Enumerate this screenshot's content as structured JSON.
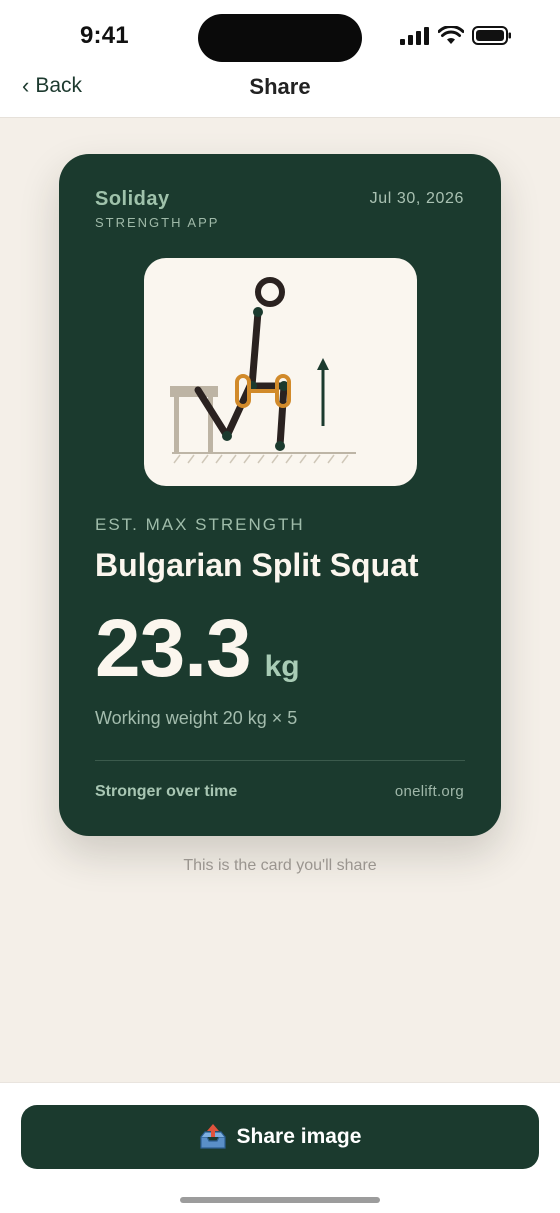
{
  "status_bar": {
    "time": "9:41"
  },
  "nav": {
    "back_label": "Back",
    "title": "Share"
  },
  "card": {
    "brand_name": "Soliday",
    "brand_sub": "STRENGTH APP",
    "date": "Jul 30, 2026",
    "illustration_icon": "bulgarian-split-squat-figure",
    "metric_label": "EST. MAX STRENGTH",
    "exercise_name": "Bulgarian Split Squat",
    "value": "23.3",
    "unit": "kg",
    "working_weight": "Working weight 20 kg × 5",
    "footer_left": "Stronger over time",
    "footer_right": "onelift.org"
  },
  "caption": "This is the card you'll share",
  "share_button": {
    "label": "Share image",
    "icon": "outbox-tray-icon"
  },
  "colors": {
    "card_bg": "#1b3a2e",
    "accent": "#d18a2a",
    "page_bg": "#f4efe8"
  }
}
